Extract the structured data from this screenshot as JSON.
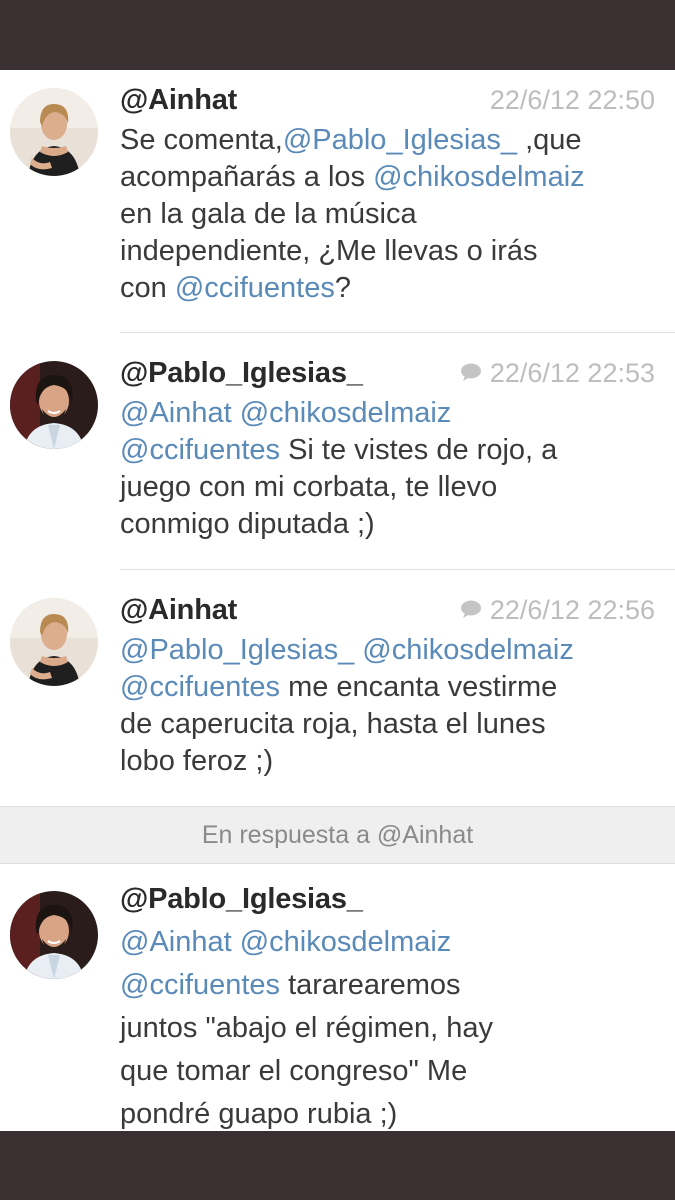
{
  "tweets": [
    {
      "handle": "@Ainhat",
      "timestamp": "22/6/12 22:50",
      "has_reply_icon": false,
      "avatar": "woman-avatar",
      "lines": [
        [
          {
            "t": "Se comenta,",
            "m": false
          },
          {
            "t": "@Pablo_Iglesias_",
            "m": true
          },
          {
            "t": " ,que",
            "m": false
          }
        ],
        [
          {
            "t": "acompañarás a los ",
            "m": false
          },
          {
            "t": "@chikosdelmaiz",
            "m": true
          }
        ],
        [
          {
            "t": "en la gala de la música",
            "m": false
          }
        ],
        [
          {
            "t": "independiente, ¿Me llevas o irás",
            "m": false
          }
        ],
        [
          {
            "t": "con ",
            "m": false
          },
          {
            "t": "@ccifuentes",
            "m": true
          },
          {
            "t": "?",
            "m": false
          }
        ]
      ]
    },
    {
      "handle": "@Pablo_Iglesias_",
      "timestamp": "22/6/12 22:53",
      "has_reply_icon": true,
      "avatar": "man-avatar",
      "lines": [
        [
          {
            "t": "@Ainhat @chikosdelmaiz",
            "m": true
          }
        ],
        [
          {
            "t": "@ccifuentes",
            "m": true
          },
          {
            "t": " Si te vistes de rojo, a",
            "m": false
          }
        ],
        [
          {
            "t": "juego con mi corbata, te llevo",
            "m": false
          }
        ],
        [
          {
            "t": "conmigo diputada ;)",
            "m": false
          }
        ]
      ]
    },
    {
      "handle": "@Ainhat",
      "timestamp": "22/6/12 22:56",
      "has_reply_icon": true,
      "avatar": "woman-avatar",
      "lines": [
        [
          {
            "t": "@Pablo_Iglesias_ @chikosdelmaiz",
            "m": true
          }
        ],
        [
          {
            "t": "@ccifuentes",
            "m": true
          },
          {
            "t": " me encanta vestirme",
            "m": false
          }
        ],
        [
          {
            "t": "de caperucita roja, hasta el lunes",
            "m": false
          }
        ],
        [
          {
            "t": "lobo feroz ;)",
            "m": false
          }
        ]
      ]
    },
    {
      "handle": "@Pablo_Iglesias_",
      "timestamp": "",
      "has_reply_icon": false,
      "avatar": "man-avatar",
      "lines": [
        [
          {
            "t": "@Ainhat @chikosdelmaiz",
            "m": true
          }
        ],
        [
          {
            "t": "@ccifuentes",
            "m": true
          },
          {
            "t": " tararearemos",
            "m": false
          }
        ],
        [
          {
            "t": "juntos \"abajo el régimen, hay",
            "m": false
          }
        ],
        [
          {
            "t": "que tomar el congreso\" Me",
            "m": false
          }
        ],
        [
          {
            "t": "pondré guapo rubia ;)",
            "m": false
          }
        ]
      ]
    }
  ],
  "reply_context": "En respuesta a @Ainhat",
  "colors": {
    "mention": "#5a8ab8",
    "text": "#3a3a3a",
    "timestamp": "#bdbdbd",
    "frame": "#3a2f31"
  }
}
